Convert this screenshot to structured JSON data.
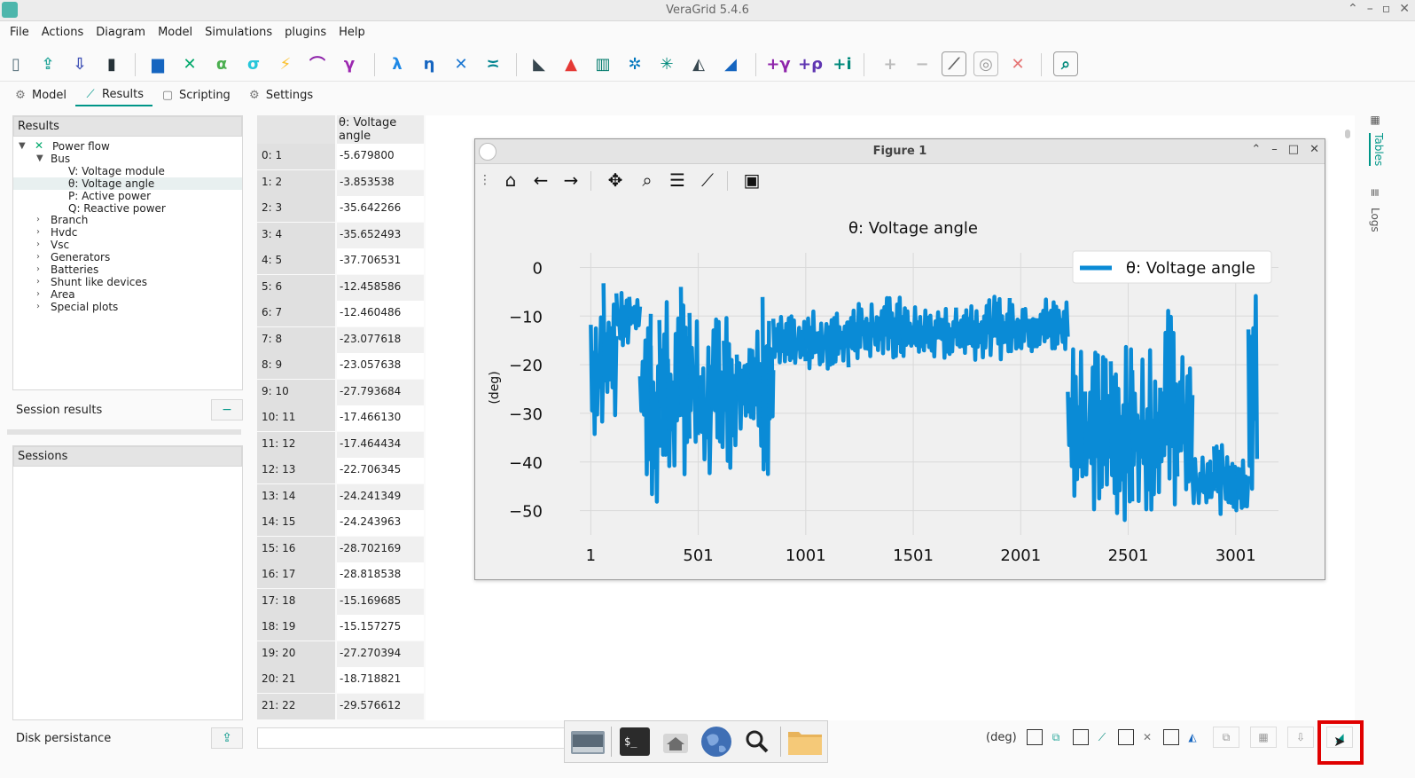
{
  "window": {
    "title": "VeraGrid 5.4.6"
  },
  "menu": [
    "File",
    "Actions",
    "Diagram",
    "Model",
    "Simulations",
    "plugins",
    "Help"
  ],
  "tabs": [
    {
      "label": "Model",
      "icon": "model-icon"
    },
    {
      "label": "Results",
      "icon": "results-chart-icon"
    },
    {
      "label": "Scripting",
      "icon": "scripting-icon"
    },
    {
      "label": "Settings",
      "icon": "gear-icon"
    }
  ],
  "toolbar_glyphs": {
    "alpha": "α",
    "sigma": "σ",
    "gamma": "γ",
    "lambda": "λ",
    "eta": "η",
    "plus": "+",
    "minus": "−"
  },
  "results_panel": {
    "header": "Results",
    "tree": {
      "root": "Power flow",
      "bus": "Bus",
      "bus_children": [
        "V: Voltage module",
        "θ: Voltage angle",
        "P: Active power",
        "Q: Reactive power"
      ],
      "selected_index": 1,
      "others": [
        "Branch",
        "Hvdc",
        "Vsc",
        "Generators",
        "Batteries",
        "Shunt like devices",
        "Area",
        "Special plots"
      ]
    }
  },
  "session_results": {
    "label": "Session results",
    "button": "−"
  },
  "sessions": {
    "header": "Sessions"
  },
  "disk": {
    "label": "Disk persistance"
  },
  "table": {
    "column_header": "θ: Voltage angle",
    "rows": [
      [
        "0: 1",
        "-5.679800"
      ],
      [
        "1: 2",
        "-3.853538"
      ],
      [
        "2: 3",
        "-35.642266"
      ],
      [
        "3: 4",
        "-35.652493"
      ],
      [
        "4: 5",
        "-37.706531"
      ],
      [
        "5: 6",
        "-12.458586"
      ],
      [
        "6: 7",
        "-12.460486"
      ],
      [
        "7: 8",
        "-23.077618"
      ],
      [
        "8: 9",
        "-23.057638"
      ],
      [
        "9: 10",
        "-27.793684"
      ],
      [
        "10: 11",
        "-17.466130"
      ],
      [
        "11: 12",
        "-17.464434"
      ],
      [
        "12: 13",
        "-22.706345"
      ],
      [
        "13: 14",
        "-24.241349"
      ],
      [
        "14: 15",
        "-24.243963"
      ],
      [
        "15: 16",
        "-28.702169"
      ],
      [
        "16: 17",
        "-28.818538"
      ],
      [
        "17: 18",
        "-15.169685"
      ],
      [
        "18: 19",
        "-15.157275"
      ],
      [
        "19: 20",
        "-27.270394"
      ],
      [
        "20: 21",
        "-18.718821"
      ],
      [
        "21: 22",
        "-29.576612"
      ]
    ]
  },
  "right_strip": {
    "tables": "Tables",
    "logs": "Logs"
  },
  "figure": {
    "window_title": "Figure 1"
  },
  "chart_data": {
    "type": "line",
    "title": "θ: Voltage angle",
    "xlabel": "",
    "ylabel": "(deg)",
    "xticks": [
      "1",
      "501",
      "1001",
      "1501",
      "2001",
      "2501",
      "3001"
    ],
    "yticks": [
      "0",
      "−10",
      "−20",
      "−30",
      "−40",
      "−50"
    ],
    "xlim": [
      -50,
      3200
    ],
    "ylim": [
      -55,
      3
    ],
    "grid": true,
    "legend": "top-right",
    "series": [
      {
        "name": "θ: Voltage angle",
        "color": "#0a8bd6",
        "segments": [
          {
            "x0": 1,
            "x1": 60,
            "lo": -38,
            "hi": -4
          },
          {
            "x0": 60,
            "x1": 120,
            "lo": -33,
            "hi": 0
          },
          {
            "x0": 120,
            "x1": 180,
            "lo": -17,
            "hi": -5
          },
          {
            "x0": 180,
            "x1": 230,
            "lo": -13,
            "hi": -6
          },
          {
            "x0": 230,
            "x1": 280,
            "lo": -47,
            "hi": -5
          },
          {
            "x0": 280,
            "x1": 320,
            "lo": -49,
            "hi": -10
          },
          {
            "x0": 320,
            "x1": 360,
            "lo": -47,
            "hi": -4
          },
          {
            "x0": 360,
            "x1": 420,
            "lo": -45,
            "hi": -10
          },
          {
            "x0": 420,
            "x1": 460,
            "lo": -43,
            "hi": 1
          },
          {
            "x0": 460,
            "x1": 500,
            "lo": -42,
            "hi": -4
          },
          {
            "x0": 500,
            "x1": 560,
            "lo": -46,
            "hi": -15
          },
          {
            "x0": 560,
            "x1": 620,
            "lo": -38,
            "hi": -9
          },
          {
            "x0": 620,
            "x1": 680,
            "lo": -42,
            "hi": -8
          },
          {
            "x0": 680,
            "x1": 740,
            "lo": -35,
            "hi": -10
          },
          {
            "x0": 740,
            "x1": 800,
            "lo": -42,
            "hi": -9
          },
          {
            "x0": 800,
            "x1": 830,
            "lo": -43,
            "hi": -4
          },
          {
            "x0": 830,
            "x1": 850,
            "lo": -35,
            "hi": -12
          },
          {
            "x0": 850,
            "x1": 1000,
            "lo": -22,
            "hi": -10
          },
          {
            "x0": 1000,
            "x1": 1200,
            "lo": -21,
            "hi": -9
          },
          {
            "x0": 1200,
            "x1": 1450,
            "lo": -19,
            "hi": -6
          },
          {
            "x0": 1450,
            "x1": 1700,
            "lo": -19,
            "hi": -8
          },
          {
            "x0": 1700,
            "x1": 1950,
            "lo": -19,
            "hi": -6
          },
          {
            "x0": 1950,
            "x1": 2220,
            "lo": -18,
            "hi": -6
          },
          {
            "x0": 2220,
            "x1": 2300,
            "lo": -48,
            "hi": -13
          },
          {
            "x0": 2300,
            "x1": 2420,
            "lo": -51,
            "hi": -17
          },
          {
            "x0": 2420,
            "x1": 2520,
            "lo": -52,
            "hi": -16
          },
          {
            "x0": 2520,
            "x1": 2650,
            "lo": -50,
            "hi": -17
          },
          {
            "x0": 2650,
            "x1": 2730,
            "lo": -49,
            "hi": -8
          },
          {
            "x0": 2730,
            "x1": 2800,
            "lo": -48,
            "hi": -18
          },
          {
            "x0": 2800,
            "x1": 2900,
            "lo": -50,
            "hi": -39
          },
          {
            "x0": 2900,
            "x1": 3010,
            "lo": -51,
            "hi": -35
          },
          {
            "x0": 3010,
            "x1": 3060,
            "lo": -50,
            "hi": -38
          },
          {
            "x0": 3060,
            "x1": 3100,
            "lo": -47,
            "hi": -5
          }
        ]
      }
    ]
  },
  "bottom": {
    "unit_label": "(deg)"
  },
  "colors": {
    "accent": "#009688",
    "series": "#0a8bd6",
    "highlight": "#e00000"
  }
}
